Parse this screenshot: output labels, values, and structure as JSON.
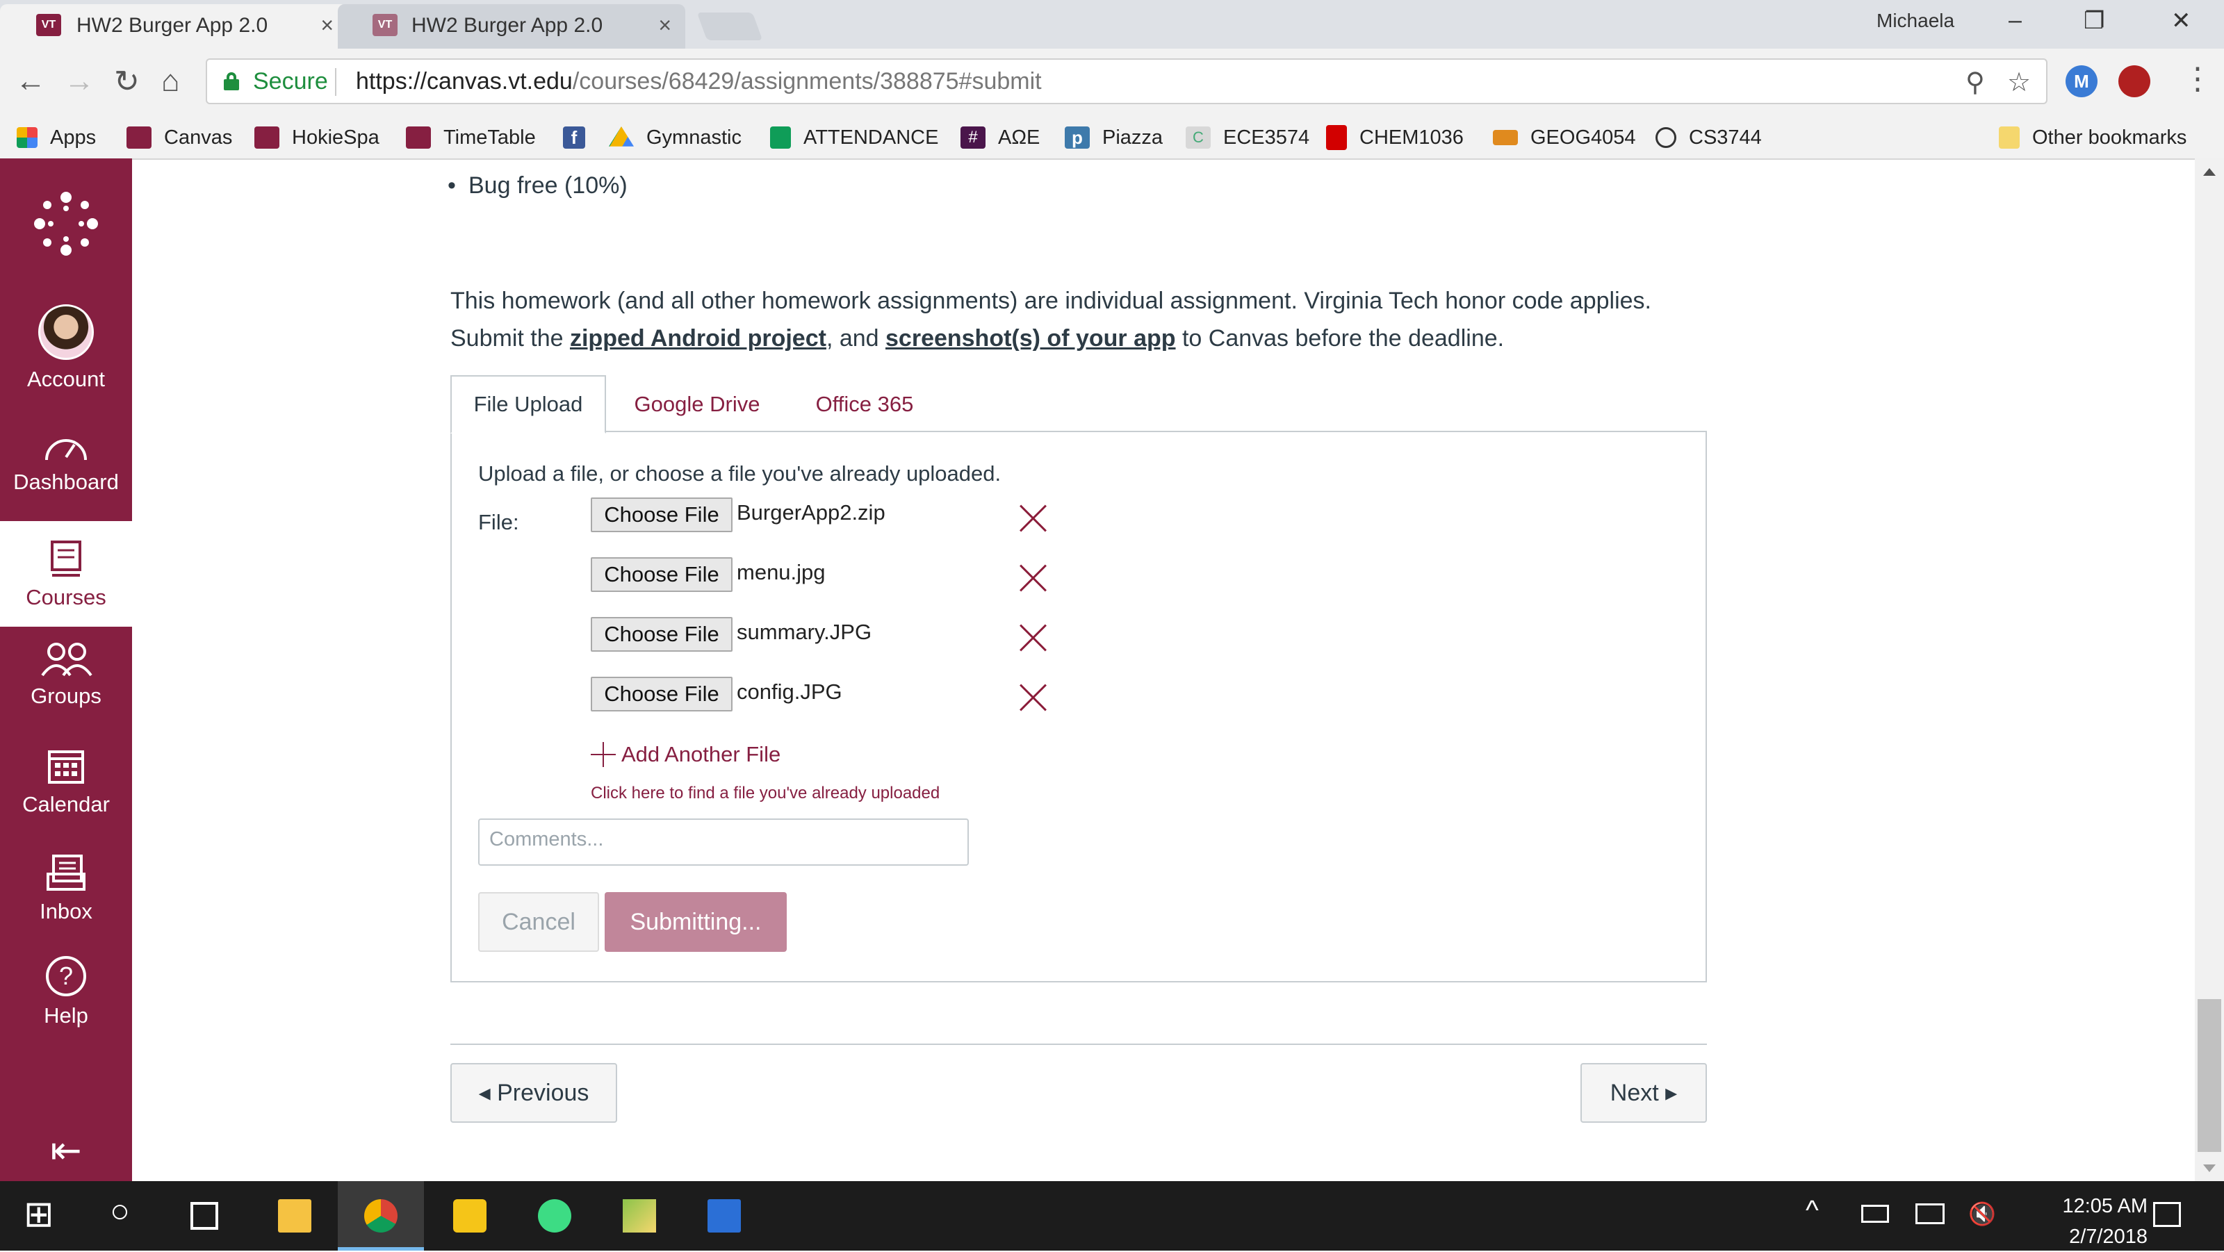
{
  "browser": {
    "tabs": [
      {
        "title": "HW2 Burger App 2.0",
        "close": "×",
        "active": true
      },
      {
        "title": "HW2 Burger App 2.0",
        "close": "×",
        "active": false
      }
    ],
    "profile": "Michaela",
    "window_controls": {
      "minimize": "–",
      "restore": "❐",
      "close": "✕"
    },
    "secure_label": "Secure",
    "url_host": "https://canvas.vt.edu",
    "url_path": "/courses/68429/assignments/388875#submit",
    "nav": {
      "back": "←",
      "forward": "→",
      "reload": "↻",
      "home": "⌂",
      "search": "⚲",
      "star": "☆",
      "menu": "⋮"
    },
    "bookmarks": [
      {
        "label": "Apps",
        "icon": "apps-grid-icon",
        "color": "#e44"
      },
      {
        "label": "Canvas",
        "icon": "vt-logo-icon",
        "color": "#861F41"
      },
      {
        "label": "HokieSpa",
        "icon": "vt-logo-icon",
        "color": "#861F41"
      },
      {
        "label": "TimeTable",
        "icon": "vt-logo-icon",
        "color": "#861F41"
      },
      {
        "label": "",
        "icon": "facebook-icon",
        "color": "#3b5998"
      },
      {
        "label": "Gymnastic",
        "icon": "google-drive-icon",
        "color": "#f4b400"
      },
      {
        "label": "ATTENDANCE",
        "icon": "google-sheets-icon",
        "color": "#0f9d58"
      },
      {
        "label": "ΑΩΕ",
        "icon": "slack-hash-icon",
        "color": "#4a154b"
      },
      {
        "label": "Piazza",
        "icon": "piazza-icon",
        "color": "#3e7aab"
      },
      {
        "label": "ECE3574",
        "icon": "cpp-icon",
        "color": "#999"
      },
      {
        "label": "CHEM1036",
        "icon": "mcgraw-hill-icon",
        "color": "#d20000"
      },
      {
        "label": "GEOG4054",
        "icon": "hat-icon",
        "color": "#e08a1e"
      },
      {
        "label": "CS3744",
        "icon": "smiley-icon",
        "color": "#333"
      }
    ],
    "other_bookmarks": "Other bookmarks"
  },
  "global_nav": {
    "items": [
      {
        "label": "",
        "icon": "canvas-logo-icon"
      },
      {
        "label": "Account",
        "icon": "avatar-icon"
      },
      {
        "label": "Dashboard",
        "icon": "dashboard-icon"
      },
      {
        "label": "Courses",
        "icon": "courses-icon",
        "active": true
      },
      {
        "label": "Groups",
        "icon": "groups-icon"
      },
      {
        "label": "Calendar",
        "icon": "calendar-icon"
      },
      {
        "label": "Inbox",
        "icon": "inbox-icon"
      },
      {
        "label": "Help",
        "icon": "help-icon"
      }
    ],
    "collapse_glyph": "⇤",
    "help_glyph": "?"
  },
  "assignment": {
    "bullet": "Bug free (10%)",
    "para_line1": "This homework (and all other homework assignments) are individual assignment. Virginia Tech honor code applies.",
    "para_submit": "Submit the ",
    "link_zip": "zipped Android project",
    "para_and": ", and ",
    "link_screens": "screenshot(s) of your app",
    "para_end": " to Canvas before the deadline."
  },
  "submission": {
    "tabs": [
      "File Upload",
      "Google Drive",
      "Office 365"
    ],
    "intro": "Upload a file, or choose a file you've already uploaded.",
    "file_label": "File:",
    "choose_label": "Choose File",
    "files": [
      "BurgerApp2.zip",
      "menu.jpg",
      "summary.JPG",
      "config.JPG"
    ],
    "add_another": "Add Another File",
    "find_uploaded": "Click here to find a file you've already uploaded",
    "comments_placeholder": "Comments...",
    "cancel": "Cancel",
    "submit": "Submitting..."
  },
  "pagination": {
    "previous": "◂ Previous",
    "next": "Next ▸"
  },
  "taskbar": {
    "start": "⊞",
    "search": "○",
    "tray_up": "^",
    "volume": "🔇",
    "time": "12:05 AM",
    "date": "2/7/2018"
  },
  "colors": {
    "brand": "#861F41",
    "secure": "#1e8e3e",
    "submit_disabled": "#c1869a"
  }
}
